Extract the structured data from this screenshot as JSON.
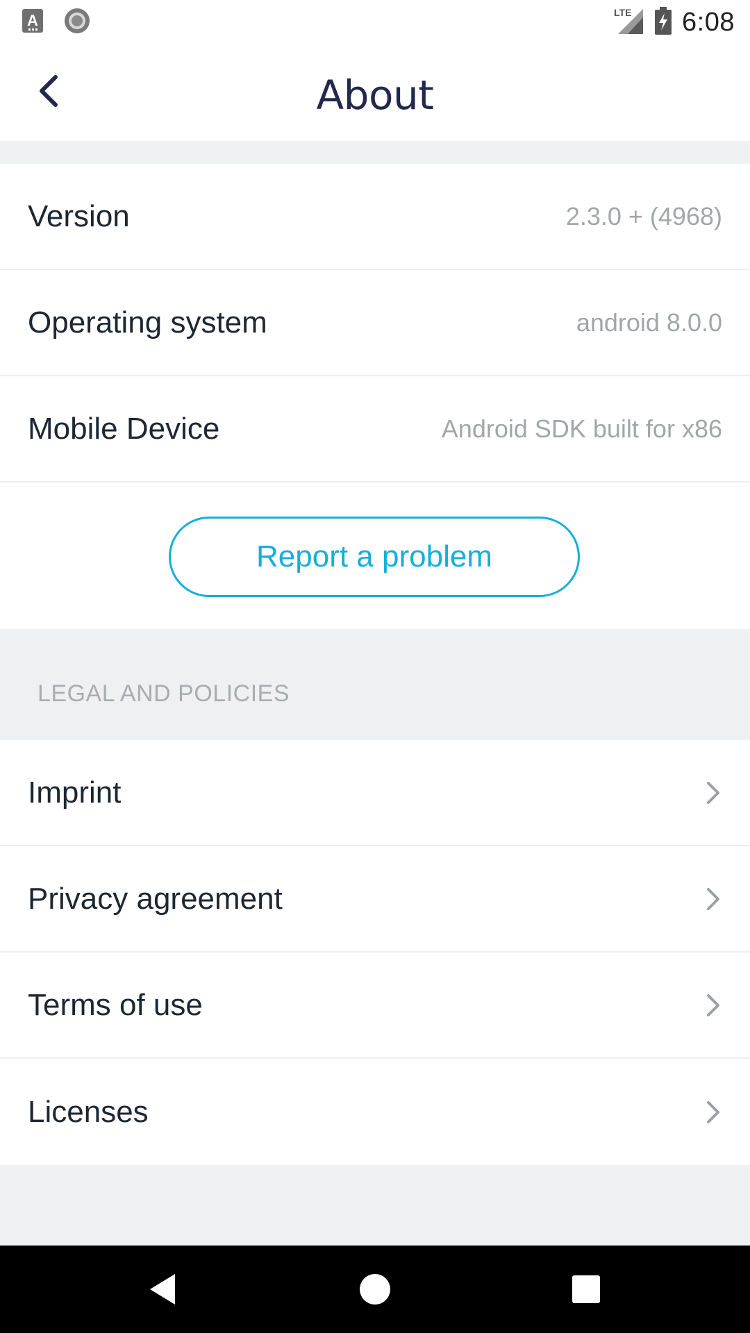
{
  "status_bar": {
    "time": "6:08",
    "network_label": "LTE",
    "icons": [
      "a-notification-icon",
      "record-icon",
      "signal-icon",
      "battery-charging-icon"
    ]
  },
  "header": {
    "title": "About",
    "back_icon": "chevron-left-icon"
  },
  "info": {
    "rows": [
      {
        "label": "Version",
        "value": "2.3.0 +  (4968)"
      },
      {
        "label": "Operating system",
        "value": "android 8.0.0"
      },
      {
        "label": "Mobile Device",
        "value": "Android SDK built for x86"
      }
    ],
    "report_button": "Report a problem"
  },
  "legal": {
    "section_title": "LEGAL AND POLICIES",
    "items": [
      {
        "label": "Imprint"
      },
      {
        "label": "Privacy agreement"
      },
      {
        "label": "Terms of use"
      },
      {
        "label": "Licenses"
      }
    ]
  },
  "nav_bar": {
    "buttons": [
      "back-triangle-icon",
      "home-circle-icon",
      "recents-square-icon"
    ]
  },
  "colors": {
    "accent": "#17aed9",
    "title": "#23294d",
    "text": "#1d2733",
    "muted": "#a2a6aa",
    "background": "#eef0f2"
  }
}
